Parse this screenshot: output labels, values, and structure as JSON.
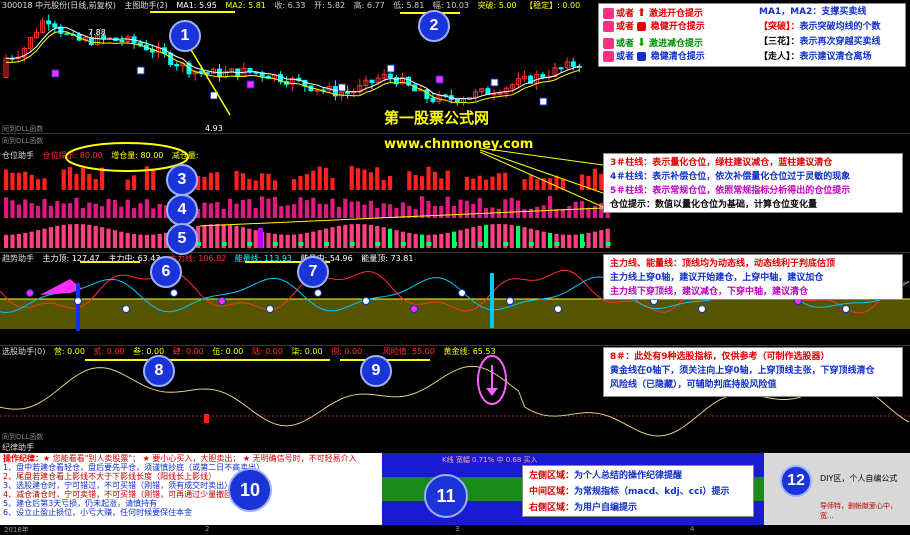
{
  "main": {
    "title": "300018 中元股份(日线,前复权)",
    "indicator": "主图助手(2)",
    "ma1": "MA1: 5.95",
    "ma2": "MA2: 5.81",
    "ohlc": [
      "收: 6.33",
      "开: 5.82",
      "高: 6.77",
      "低: 5.81",
      "幅: 10.03"
    ],
    "flags": [
      "突破: 5.00",
      "【稳定】: 0.00"
    ],
    "price_hi": "7.88",
    "price_lo": "4.93"
  },
  "legend": {
    "left": [
      {
        "prefix": "或者",
        "text": "激进开仓提示",
        "icon": "red-up-arrow-icon",
        "color": "#e00000"
      },
      {
        "prefix": "或者",
        "text": "稳健开仓提示",
        "icon": "red-square-icon",
        "color": "#e00000"
      },
      {
        "prefix": "或者",
        "text": "激进减仓提示",
        "icon": "green-down-arrow-icon",
        "color": "#009000"
      },
      {
        "prefix": "或者",
        "text": "稳健清仓提示",
        "icon": "blue-square-icon",
        "color": "#1030c8"
      }
    ],
    "right": [
      {
        "key": "MA1，MA2：",
        "text": "支撑买卖线"
      },
      {
        "key": "【突破】：",
        "text": "表示突破均线的个数"
      },
      {
        "key": "【三花】：",
        "text": "表示再次穿越买卖线"
      },
      {
        "key": "【走人】：",
        "text": "表示建议清仓离场"
      }
    ]
  },
  "watermark": {
    "line1": "第一股票公式网",
    "line2": "www.chnmoney.com"
  },
  "position_pane": {
    "title": "仓位助手",
    "label1": "仓位提示: 80.00",
    "label2": "增仓量: 80.00",
    "label3": "减仓量:",
    "notes": [
      {
        "num": "3＃柱线：",
        "text": "表示量化仓位，绿柱建议减仓，蓝柱建议清仓"
      },
      {
        "num": "4＃柱线：",
        "text": "表示补偿仓位，依次补偿量化仓位过于灵敏的现象"
      },
      {
        "num": "5＃柱线：",
        "text": "表示常规仓位，依照常规指标分析得出的仓位提示"
      },
      {
        "num": "仓位提示：",
        "text": "数值以量化仓位为基础，计算仓位变化量"
      }
    ]
  },
  "trend_pane": {
    "title": "趋势助手",
    "labels": [
      "主力顶: 127.47",
      "主力中: 63.43",
      "主力线: 106.82",
      "能量线: 113.93",
      "能量中: 54.96",
      "能量顶: 73.81"
    ],
    "notes": [
      "主力线、能量线：顶线均为动态线，动态线利于判底估顶",
      "主力线上穿0轴，建议开始建仓，上穿中轴，建议加仓",
      "主力线下穿顶线，建议减仓，下穿中轴，建议清仓"
    ]
  },
  "select_pane": {
    "title": "选股助手(0)",
    "labels": [
      "营: 0.00",
      "贰: 0.00",
      "叁: 0.00",
      "肆: 0.00",
      "伍: 0.00",
      "陆: 0.00",
      "柒: 0.00",
      "捌: 0.00"
    ],
    "risk": "风险值: 55.00",
    "gold": "黄金线: 65.53",
    "notes": [
      "8＃：此处有9种选股指标，仅供参考（可制作选股器）",
      "黄金线在0轴下，须关注向上穿0轴，上穿顶线主张，下穿顶线清仓",
      "风险线（已隐藏），可辅助判底持股风险值"
    ]
  },
  "bottom": {
    "left_title": "操作纪律：",
    "left_sub": "★ 您能看看\"别人卖股票\"； ★ 要小心买入，大胆卖出； ★ 无明确信号时，不可轻易介入",
    "left_items": [
      "1、盘中若建仓看轻仓，盘后要先平仓，须谨慎抄底（或第二日不高卖出）",
      "2、尾盘若建仓看上影线不大于下影线长度（阳线长上影线）",
      "3、选股建仓时，宁可错过，不可买错（刚错，须有成交时卖出）",
      "4、减仓清仓时，宁可卖错，不可买错（刚错，可再通过少量撤回）",
      "5、建仓后第3天亏损，仍未起涨，请慎持有",
      "6、设立止盈止损位，小亏大赚，任何时候要保住本金"
    ],
    "mid_header": "K线 宽幅 0.71% 中 0.68 买入",
    "mid_notes": [
      {
        "key": "左侧区域：",
        "text": "为个人总结的操作纪律提醒"
      },
      {
        "key": "中间区域：",
        "text": "为常规指标（macd、kdj、cci）提示"
      },
      {
        "key": "右侧区域：",
        "text": "为用户自编提示"
      }
    ],
    "right_title": "DIY区，个人自编公式",
    "right_foot": "导师特，删帐献爱心中，宽..."
  },
  "sub_labels": {
    "dll1": "同到DLL函数",
    "dll2": "同到DLL函数",
    "dll3": "同到DLL函数",
    "jilu": "纪律助手"
  },
  "bubbles": [
    "1",
    "2",
    "3",
    "4",
    "5",
    "6",
    "7",
    "8",
    "9",
    "10",
    "11",
    "12"
  ],
  "status": {
    "year": "2018年",
    "m1": "2",
    "m2": "3",
    "m3": "4"
  },
  "colors": {
    "up": "#ff3030",
    "down": "#00ffff",
    "ma1": "#ffffff",
    "ma2": "#ffff00",
    "legend_bg": "#ffffff",
    "highlight": "#ffff00"
  }
}
